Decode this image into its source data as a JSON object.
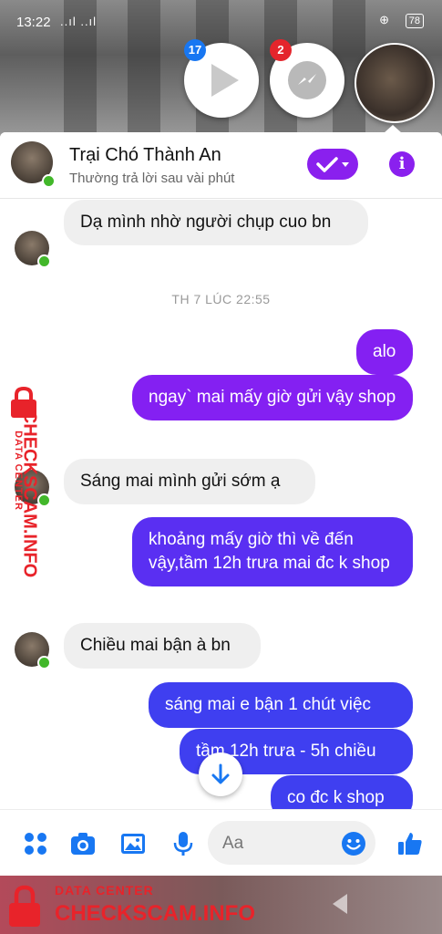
{
  "status_bar": {
    "time": "13:22",
    "signal": "..ıl ..ıl",
    "battery": "78"
  },
  "bubbles": {
    "video_badge": "17",
    "messenger_badge": "2"
  },
  "header": {
    "name": "Trại Chó Thành An",
    "subtitle": "Thường trả lời sau vài phút"
  },
  "messages": [
    {
      "side": "in",
      "text": "Dạ mình nhờ người chụp cuo bn"
    },
    {
      "side": "out",
      "text": "alo"
    },
    {
      "side": "out",
      "text": "ngay` mai mấy giờ gửi vậy shop"
    },
    {
      "side": "in",
      "text": "Sáng mai mình gửi sớm ạ"
    },
    {
      "side": "out",
      "text": "khoảng mấy giờ thì về đến vậy,tầm 12h trưa mai đc k shop"
    },
    {
      "side": "in",
      "text": "Chiều mai bận à bn"
    },
    {
      "side": "out",
      "text": "sáng mai e bận 1 chút việc"
    },
    {
      "side": "out",
      "text": "tầm 12h trưa - 5h chiều"
    },
    {
      "side": "out",
      "text": "co đc k shop"
    }
  ],
  "timestamp": "TH 7 LÚC 22:55",
  "composer": {
    "placeholder": "Aa"
  },
  "watermark": {
    "brand": "CHECKSCAM.INFO",
    "subtitle": "DATA CENTER"
  },
  "colors": {
    "accent": "#8a20ee",
    "outgoing_blue": "#3f3ff0",
    "online": "#42b72a",
    "watermark": "#e8232a"
  },
  "icons": [
    "menu-dots-icon",
    "camera-icon",
    "image-icon",
    "microphone-icon",
    "emoji-icon",
    "thumbs-up-icon",
    "check-icon",
    "info-icon",
    "arrow-down-icon",
    "play-icon",
    "messenger-icon"
  ]
}
